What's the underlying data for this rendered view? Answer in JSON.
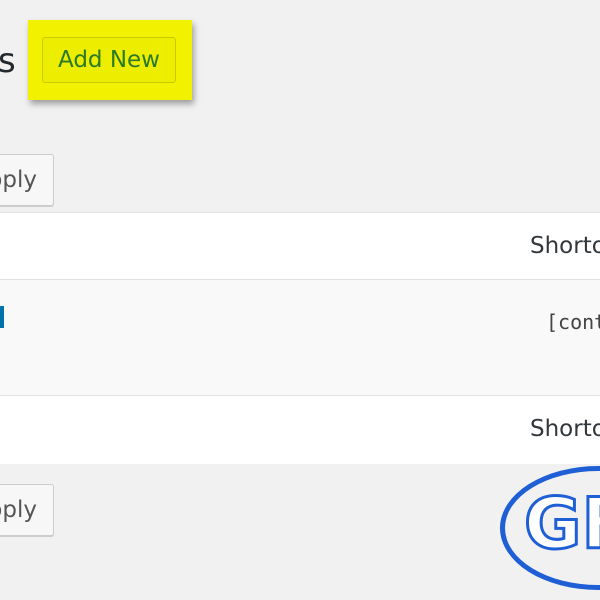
{
  "header": {
    "title_visible_fragment": "s",
    "add_new_label": "Add New"
  },
  "bulk_actions": {
    "apply_top_label": "pply",
    "apply_bottom_label": "pply"
  },
  "table": {
    "column_header_label": "Shorto",
    "column_footer_label": "Shorto",
    "rows": [
      {
        "shortcode": "[cont"
      }
    ]
  },
  "watermark": {
    "text": "GF"
  },
  "colors": {
    "background": "#f1f1f1",
    "highlight": "#f2f200",
    "add_new_text": "#2a7a2a",
    "link_blue": "#0073aa",
    "watermark_blue": "#1f5fd6"
  }
}
